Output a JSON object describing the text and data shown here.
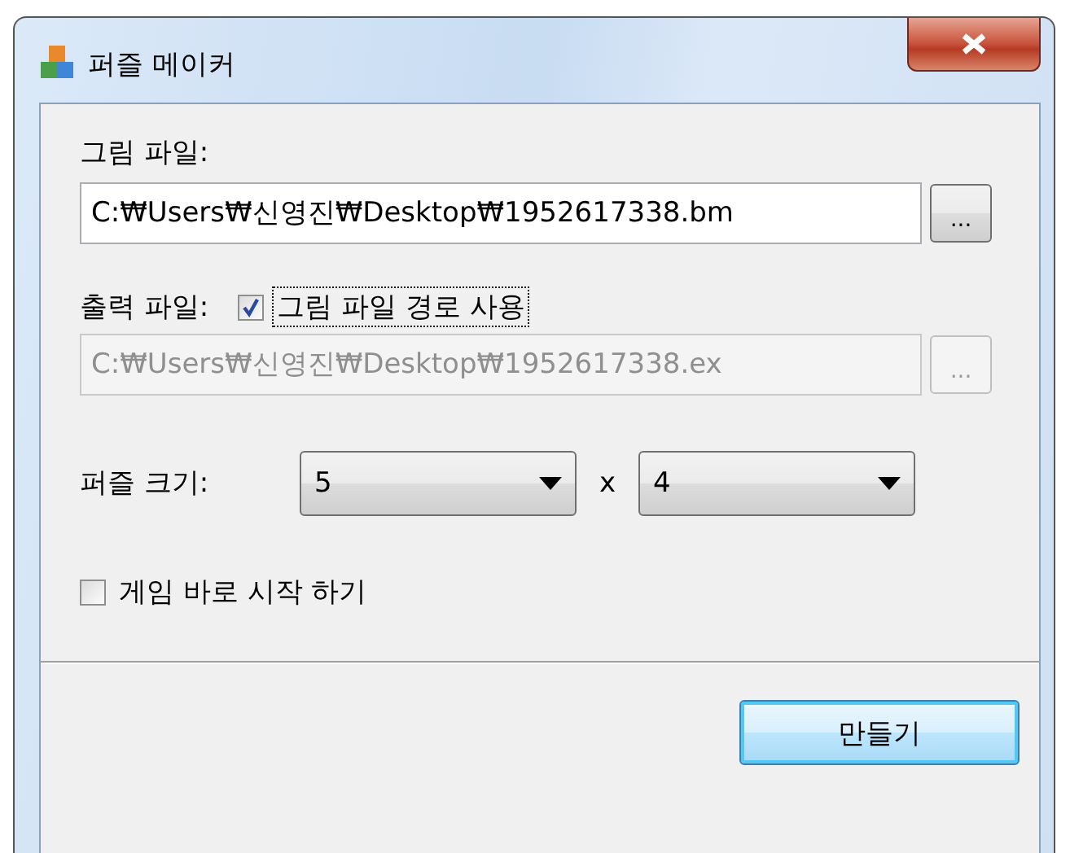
{
  "window": {
    "title": "퍼즐 메이커"
  },
  "image_file": {
    "label": "그림 파일:",
    "value": "C:₩Users₩신영진₩Desktop₩1952617338.bm",
    "browse": "...",
    "disabled": false
  },
  "output_file": {
    "label": "출력 파일:",
    "use_image_path": {
      "label": "그림 파일 경로 사용",
      "checked": true,
      "focused": true
    },
    "value": "C:₩Users₩신영진₩Desktop₩1952617338.ex",
    "browse": "...",
    "disabled": true
  },
  "puzzle_size": {
    "label": "퍼즐 크기:",
    "columns": "5",
    "separator": "x",
    "rows": "4"
  },
  "start_game": {
    "label": "게임 바로 시작 하기",
    "checked": false
  },
  "buttons": [
    {
      "label": "만들기",
      "default": true
    }
  ]
}
